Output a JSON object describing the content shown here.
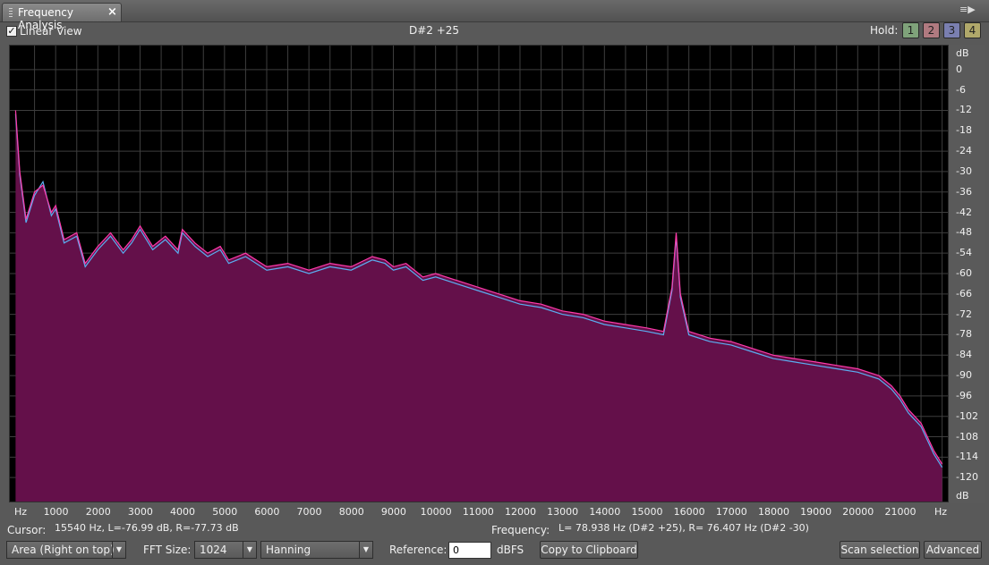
{
  "panel": {
    "tab_title": "Frequency Analysis",
    "close_glyph": "×",
    "menu_glyph": "≡▶"
  },
  "toolbar": {
    "linear_view_label": "Linear View",
    "linear_view_checked": true,
    "note_readout": "D#2 +25",
    "hold_label": "Hold:",
    "hold_buttons": [
      {
        "label": "1",
        "color": "#7fa27a"
      },
      {
        "label": "2",
        "color": "#b07a80"
      },
      {
        "label": "3",
        "color": "#7a7fb0"
      },
      {
        "label": "4",
        "color": "#b0a86a"
      }
    ]
  },
  "chart_data": {
    "type": "area",
    "x_unit": "Hz",
    "y_unit": "dB",
    "xlim": [
      0,
      22050
    ],
    "ylim": [
      -126,
      6
    ],
    "x_ticks": [
      1000,
      2000,
      3000,
      4000,
      5000,
      6000,
      7000,
      8000,
      9000,
      10000,
      11000,
      12000,
      13000,
      14000,
      15000,
      16000,
      17000,
      18000,
      19000,
      20000,
      21000
    ],
    "y_ticks": [
      0,
      -6,
      -12,
      -18,
      -24,
      -30,
      -36,
      -42,
      -48,
      -54,
      -60,
      -66,
      -72,
      -78,
      -84,
      -90,
      -96,
      -102,
      -108,
      -114,
      -120
    ],
    "grid": true,
    "series": [
      {
        "color": "#ff3aaa",
        "fill": "#64104a",
        "x": [
          50,
          150,
          300,
          500,
          700,
          900,
          1000,
          1200,
          1500,
          1700,
          2000,
          2300,
          2600,
          2800,
          3000,
          3300,
          3600,
          3900,
          4000,
          4300,
          4600,
          4900,
          5100,
          5500,
          6000,
          6500,
          7000,
          7500,
          8000,
          8500,
          8800,
          9000,
          9300,
          9700,
          10000,
          10500,
          11000,
          11500,
          12000,
          12500,
          13000,
          13500,
          14000,
          14500,
          15000,
          15400,
          15600,
          15700,
          15800,
          16000,
          16500,
          17000,
          17500,
          18000,
          18500,
          19000,
          19500,
          20000,
          20500,
          20800,
          21000,
          21200,
          21500,
          21800,
          22000
        ],
        "values": [
          -12,
          -30,
          -44,
          -36,
          -34,
          -42,
          -40,
          -50,
          -48,
          -57,
          -52,
          -48,
          -53,
          -50,
          -46,
          -52,
          -49,
          -53,
          -47,
          -51,
          -54,
          -52,
          -56,
          -54,
          -58,
          -57,
          -59,
          -57,
          -58,
          -55,
          -56,
          -58,
          -57,
          -61,
          -60,
          -62,
          -64,
          -66,
          -68,
          -69,
          -71,
          -72,
          -74,
          -75,
          -76,
          -77,
          -64,
          -48,
          -66,
          -77,
          -79,
          -80,
          -82,
          -84,
          -85,
          -86,
          -87,
          -88,
          -90,
          -93,
          -96,
          -100,
          -104,
          -112,
          -116
        ]
      },
      {
        "color": "#5aaef0",
        "x": [
          50,
          150,
          300,
          500,
          700,
          900,
          1000,
          1200,
          1500,
          1700,
          2000,
          2300,
          2600,
          2800,
          3000,
          3300,
          3600,
          3900,
          4000,
          4300,
          4600,
          4900,
          5100,
          5500,
          6000,
          6500,
          7000,
          7500,
          8000,
          8500,
          8800,
          9000,
          9300,
          9700,
          10000,
          10500,
          11000,
          11500,
          12000,
          12500,
          13000,
          13500,
          14000,
          14500,
          15000,
          15400,
          15600,
          15700,
          15800,
          16000,
          16500,
          17000,
          17500,
          18000,
          18500,
          19000,
          19500,
          20000,
          20500,
          20800,
          21000,
          21200,
          21500,
          21800,
          22000
        ],
        "values": [
          -13,
          -31,
          -45,
          -37,
          -33,
          -43,
          -41,
          -51,
          -49,
          -58,
          -53,
          -49,
          -54,
          -51,
          -47,
          -53,
          -50,
          -54,
          -48,
          -52,
          -55,
          -53,
          -57,
          -55,
          -59,
          -58,
          -60,
          -58,
          -59,
          -56,
          -57,
          -59,
          -58,
          -62,
          -61,
          -63,
          -65,
          -67,
          -69,
          -70,
          -72,
          -73,
          -75,
          -76,
          -77,
          -78,
          -65,
          -49,
          -67,
          -78,
          -80,
          -81,
          -83,
          -85,
          -86,
          -87,
          -88,
          -89,
          -91,
          -94,
          -97,
          -101,
          -105,
          -113,
          -117
        ]
      }
    ]
  },
  "axes": {
    "db_top_label": "dB",
    "db_bottom_label": "dB",
    "hz_left_label": "Hz",
    "hz_right_label": "Hz",
    "db_labels": [
      "0",
      "-6",
      "-12",
      "-18",
      "-24",
      "-30",
      "-36",
      "-42",
      "-48",
      "-54",
      "-60",
      "-66",
      "-72",
      "-78",
      "-84",
      "-90",
      "-96",
      "-102",
      "-108",
      "-114",
      "-120"
    ],
    "hz_labels": [
      "1000",
      "2000",
      "3000",
      "4000",
      "5000",
      "6000",
      "7000",
      "8000",
      "9000",
      "10000",
      "11000",
      "12000",
      "13000",
      "14000",
      "15000",
      "16000",
      "17000",
      "18000",
      "19000",
      "20000",
      "21000"
    ]
  },
  "status": {
    "cursor_label": "Cursor:",
    "cursor_value": "15540 Hz, L=-76.99 dB, R=-77.73 dB",
    "frequency_label": "Frequency:",
    "frequency_value": "L= 78.938 Hz (D#2 +25), R= 76.407 Hz (D#2 -30)"
  },
  "controls": {
    "display_mode": "Area (Right on top)",
    "fft_label": "FFT Size:",
    "fft_value": "1024",
    "window_value": "Hanning",
    "reference_label": "Reference:",
    "reference_value": "0",
    "reference_unit": "dBFS",
    "copy_button": "Copy to Clipboard",
    "scan_button": "Scan selection",
    "advanced_button": "Advanced"
  }
}
